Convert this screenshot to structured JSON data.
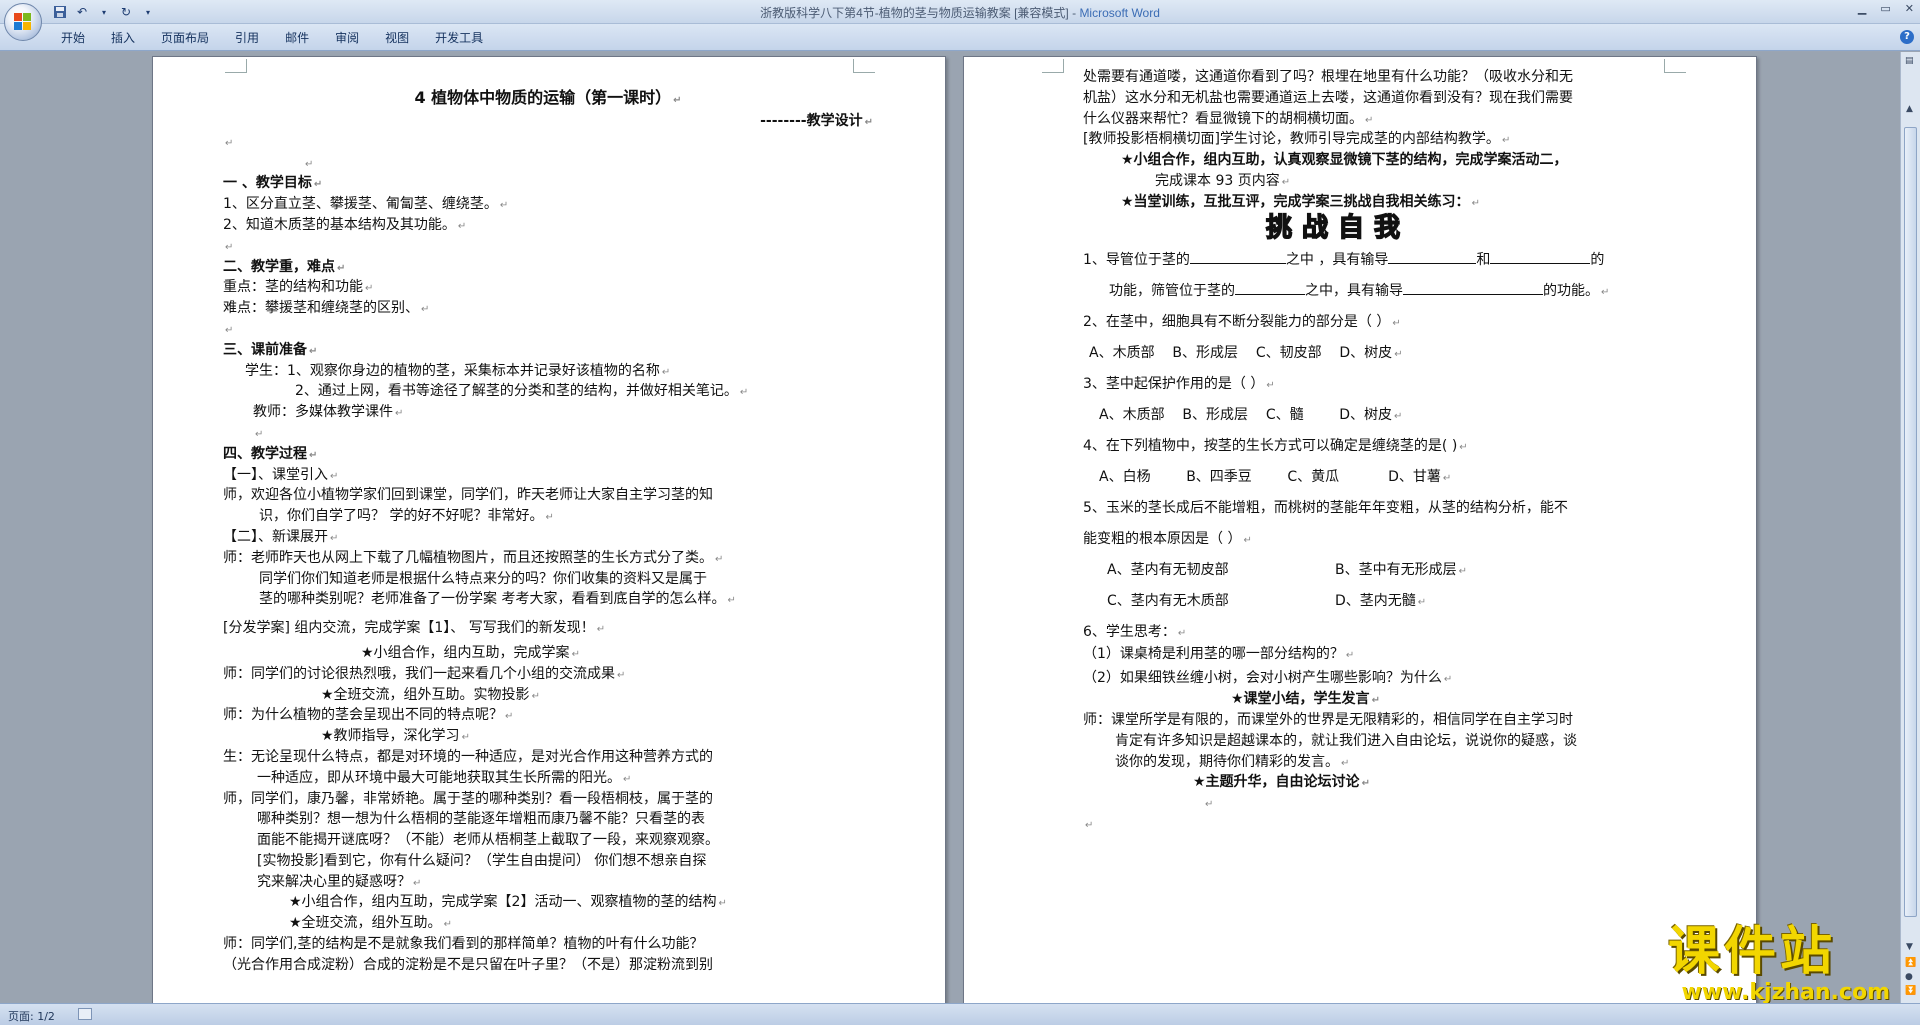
{
  "window": {
    "title": "浙教版科学八下第4节-植物的茎与物质运输教案 [兼容模式] - ",
    "app_name": "Microsoft Word"
  },
  "ribbon": {
    "tabs": [
      "开始",
      "插入",
      "页面布局",
      "引用",
      "邮件",
      "审阅",
      "视图",
      "开发工具"
    ]
  },
  "status": {
    "page": "页面: 1/2"
  },
  "watermark": {
    "big": "课件站",
    "url": "www.kjzhan.com"
  },
  "page1": {
    "title": "4 植物体中物质的运输（第一课时）",
    "subtitle": "--------教学设计",
    "lines": [
      "",
      "一 、教学目标",
      "1、区分直立茎、攀援茎、匍匐茎、缠绕茎。",
      "2、知道木质茎的基本结构及其功能。",
      "",
      "二、教学重，难点",
      "重点：茎的结构和功能",
      "难点：攀援茎和缠绕茎的区别、",
      "",
      "三、课前准备",
      "学生：1、观察你身边的植物的茎，采集标本并记录好该植物的名称",
      "2、通过上网，看书等途径了解茎的分类和茎的结构，并做好相关笔记。",
      "教师：多媒体教学课件",
      "",
      "四、教学过程",
      "【一】、课堂引入",
      "师，欢迎各位小植物学家们回到课堂，同学们，昨天老师让大家自主学习茎的知",
      "识，你们自学了吗？ 学的好不好呢？非常好。",
      "【二】、新课展开",
      "师：老师昨天也从网上下载了几幅植物图片，而且还按照茎的生长方式分了类。",
      "同学们你们知道老师是根据什么特点来分的吗？你们收集的资料又是属于",
      "茎的哪种类别呢？老师准备了一份学案 考考大家，看看到底自学的怎么样。",
      "[分发学案]    组内交流，完成学案【1】、 写写我们的新发现！",
      "★小组合作，组内互助，完成学案",
      "师：同学们的讨论很热烈哦，我们一起来看几个小组的交流成果",
      "★全班交流，组外互助。实物投影",
      "师：为什么植物的茎会呈现出不同的特点呢？",
      "★教师指导，深化学习",
      "生：无论呈现什么特点，都是对环境的一种适应，是对光合作用这种营养方式的",
      "一种适应，即从环境中最大可能地获取其生长所需的阳光。",
      "师，同学们，康乃馨，非常娇艳。属于茎的哪种类别？看一段梧桐枝，属于茎的",
      "哪种类别？想一想为什么梧桐的茎能逐年增粗而康乃馨不能？只看茎的表",
      "面能不能揭开谜底呀？（不能）老师从梧桐茎上截取了一段，来观察观察。",
      "[实物投影]看到它，你有什么疑问？（学生自由提问） 你们想不想亲自探",
      "究来解决心里的疑惑呀？",
      "★小组合作，组内互助，完成学案【2】活动一、观察植物的茎的结构",
      "★全班交流，组外互助。",
      "师：同学们,茎的结构是不是就象我们看到的那样简单？植物的叶有什么功能？",
      "（光合作用合成淀粉）合成的淀粉是不是只留在叶子里？（不是）那淀粉流到别"
    ]
  },
  "page2": {
    "lines": [
      "处需要有通道喽，这通道你看到了吗？根埋在地里有什么功能？（吸收水分和无",
      "机盐）这水分和无机盐也需要通道运上去喽，这通道你看到没有？现在我们需要",
      "什么仪器来帮忙？看显微镜下的胡桐横切面。",
      "[教师投影梧桐横切面]学生讨论，教师引导完成茎的内部结构教学。",
      "★小组合作，组内互助，认真观察显微镜下茎的结构，完成学案活动二，",
      "完成课本 93 页内容",
      "★当堂训练，互批互评，完成学案三挑战自我相关练习："
    ],
    "challenge_title": "挑战自我",
    "q1a_1": "1、导管位于茎的",
    "q1a_2": "之中 ，具有输导",
    "q1a_3": "和",
    "q1a_4": "的",
    "q1b_1": "功能，筛管位于茎的",
    "q1b_2": "之中，具有输导",
    "q1b_3": "的功能。",
    "q2": "2、在茎中，细胞具有不断分裂能力的部分是（        ）",
    "q2_opts": [
      "A、木质部",
      "B、形成层",
      "C、韧皮部",
      "D、树皮"
    ],
    "q3": "3、茎中起保护作用的是（        ）",
    "q3_opts": [
      "A、木质部",
      "B、形成层",
      "C、髓",
      "D、树皮"
    ],
    "q4": "4、在下列植物中，按茎的生长方式可以确定是缠绕茎的是(          )",
    "q4_opts": [
      "A、白杨",
      "B、四季豆",
      "C、黄瓜",
      "D、甘薯"
    ],
    "q5a": "5、玉米的茎长成后不能增粗，而桃树的茎能年年变粗，从茎的结构分析，能不",
    "q5b": "能变粗的根本原因是（      ）",
    "q5_opts": [
      "A、茎内有无韧皮部",
      "B、茎中有无形成层",
      "C、茎内有无木质部",
      "D、茎内无髓"
    ],
    "q6": "6、学生思考：",
    "q6_1": "（1）课桌椅是利用茎的哪一部分结构的？",
    "q6_2": "（2）如果细铁丝缠小树，会对小树产生哪些影响？为什么",
    "summary_head": "★课堂小结，学生发言",
    "summary_1": "师：课堂所学是有限的，而课堂外的世界是无限精彩的，相信同学在自主学习时",
    "summary_2": "肯定有许多知识是超越课本的，就让我们进入自由论坛，说说你的疑惑，谈",
    "summary_3": "谈你的发现，期待你们精彩的发言。",
    "theme": "★主题升华，自由论坛讨论"
  }
}
